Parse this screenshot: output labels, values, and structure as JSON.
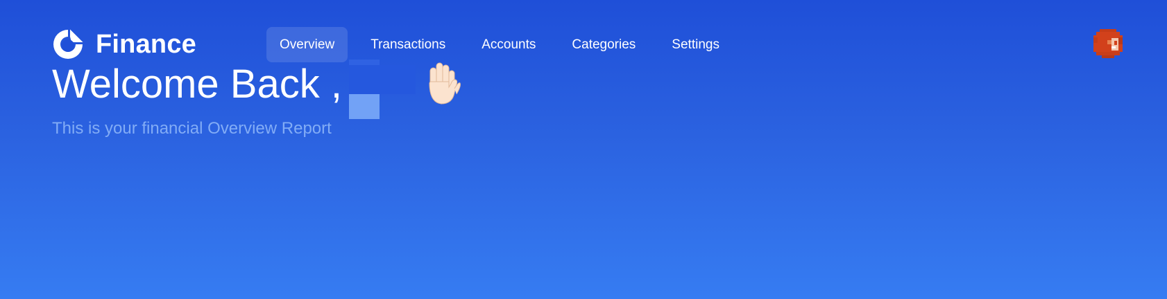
{
  "brand": {
    "name": "Finance",
    "logo_icon": "donut-logo-icon"
  },
  "nav": {
    "items": [
      {
        "label": "Overview",
        "active": true
      },
      {
        "label": "Transactions",
        "active": false
      },
      {
        "label": "Accounts",
        "active": false
      },
      {
        "label": "Categories",
        "active": false
      },
      {
        "label": "Settings",
        "active": false
      }
    ]
  },
  "user": {
    "avatar_icon": "pixel-avatar-icon",
    "avatar_color": "#d2411b"
  },
  "welcome": {
    "title": "Welcome Back ,",
    "emoji_icon": "raised-hand-icon",
    "subtitle": "This is your financial Overview Report"
  },
  "colors": {
    "background_top": "#1f4fd8",
    "background_bottom": "#367cf2",
    "subtitle": "#82acf6",
    "nav_active_bg": "rgba(255,255,255,0.13)"
  }
}
